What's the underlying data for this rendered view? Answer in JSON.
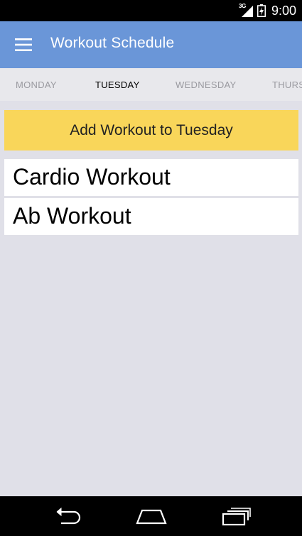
{
  "status_bar": {
    "network": "3G",
    "time": "9:00",
    "icons": [
      "signal-icon",
      "battery-icon"
    ]
  },
  "app_bar": {
    "title": "Workout Schedule",
    "menu_icon": "hamburger-menu-icon",
    "background_color": "#6a96d8"
  },
  "tabs": [
    {
      "label": "MONDAY",
      "active": false
    },
    {
      "label": "TUESDAY",
      "active": true
    },
    {
      "label": "WEDNESDAY",
      "active": false
    },
    {
      "label": "THURS",
      "active": false
    }
  ],
  "add_button": {
    "label": "Add Workout to Tuesday",
    "color": "#f9d65a"
  },
  "workouts": [
    {
      "name": "Cardio Workout"
    },
    {
      "name": "Ab Workout"
    }
  ],
  "nav_bar": {
    "icons": [
      "back-icon",
      "home-icon",
      "recent-apps-icon"
    ]
  }
}
